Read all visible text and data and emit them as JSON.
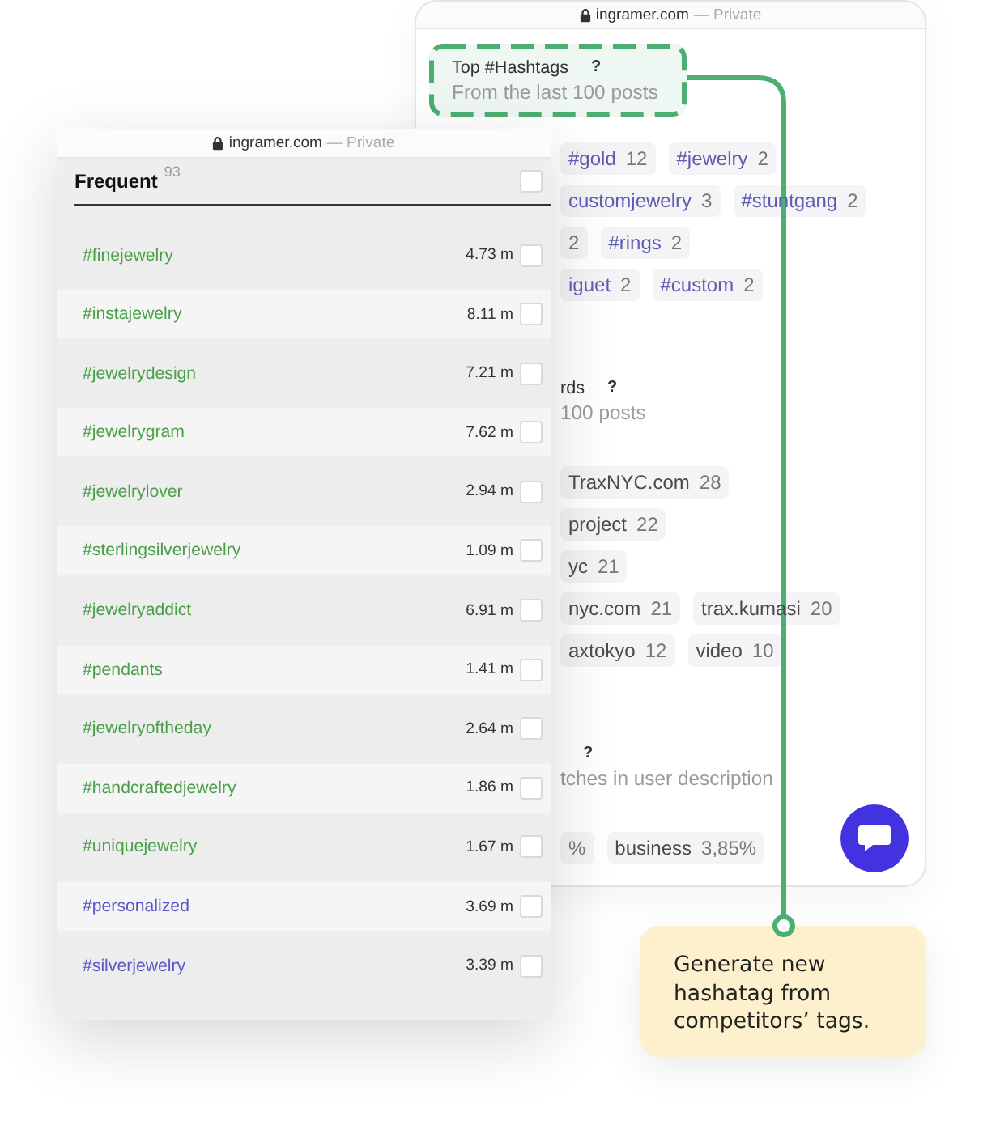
{
  "back_window": {
    "address_bar": {
      "domain": "ingramer.com",
      "mode": "— Private"
    },
    "sections": [
      {
        "kind": "hashtags",
        "highlighted": true,
        "title": "Top #Hashtags",
        "help": "?",
        "subtitle": "From the last 100 posts",
        "chip_rows": [
          [
            {
              "label": "#gold",
              "count": "12"
            },
            {
              "label": "#jewelry",
              "count": "2"
            }
          ],
          [
            {
              "label": "customjewelry",
              "count": "3"
            },
            {
              "label": "#stuntgang",
              "count": "2"
            }
          ],
          [
            {
              "count": "2"
            },
            {
              "label": "#rings",
              "count": "2"
            }
          ],
          [
            {
              "label": "iguet",
              "count": "2"
            },
            {
              "label": "#custom",
              "count": "2"
            }
          ]
        ]
      },
      {
        "kind": "words",
        "highlighted": false,
        "title": "rds",
        "help": "?",
        "subtitle": "100 posts",
        "chip_rows": [
          [
            {
              "label": "TraxNYC.com",
              "count": "28"
            }
          ],
          [
            {
              "label": "project",
              "count": "22"
            }
          ],
          [
            {
              "label": "yc",
              "count": "21"
            }
          ],
          [
            {
              "label": "nyc.com",
              "count": "21"
            },
            {
              "label": "trax.kumasi",
              "count": "20"
            }
          ],
          [
            {
              "label": "axtokyo",
              "count": "12"
            },
            {
              "label": "video",
              "count": "10"
            }
          ]
        ]
      },
      {
        "kind": "words",
        "highlighted": false,
        "help": "?",
        "subtitle": "tches in user description",
        "chip_rows": [
          [
            {
              "count": "%"
            },
            {
              "label": "business",
              "count": "3,85%"
            }
          ]
        ]
      }
    ]
  },
  "front_window": {
    "address_bar": {
      "domain": "ingramer.com",
      "mode": "— Private"
    },
    "heading": "Frequent",
    "total": "93",
    "select_all": {
      "checked": false
    },
    "rows": [
      {
        "tag": "#finejewelry",
        "color": "#4a9f48",
        "reach": "4.73 m",
        "checked": false
      },
      {
        "tag": "#instajewelry",
        "color": "#4a9f48",
        "reach": "8.11 m",
        "checked": false
      },
      {
        "tag": "#jewelrydesign",
        "color": "#4a9f48",
        "reach": "7.21 m",
        "checked": false
      },
      {
        "tag": "#jewelrygram",
        "color": "#4a9f48",
        "reach": "7.62 m",
        "checked": false
      },
      {
        "tag": "#jewelrylover",
        "color": "#4a9f48",
        "reach": "2.94 m",
        "checked": false
      },
      {
        "tag": "#sterlingsilverjewelry",
        "color": "#4a9f48",
        "reach": "1.09 m",
        "checked": false
      },
      {
        "tag": "#jewelryaddict",
        "color": "#4a9f48",
        "reach": "6.91 m",
        "checked": false
      },
      {
        "tag": "#pendants",
        "color": "#4a9f48",
        "reach": "1.41 m",
        "checked": false
      },
      {
        "tag": "#jewelryoftheday",
        "color": "#4a9f48",
        "reach": "2.64 m",
        "checked": false
      },
      {
        "tag": "#handcraftedjewelry",
        "color": "#4a9f48",
        "reach": "1.86 m",
        "checked": false
      },
      {
        "tag": "#uniquejewelry",
        "color": "#4a9f48",
        "reach": "1.67 m",
        "checked": false
      },
      {
        "tag": "#personalized",
        "color": "#5a58c8",
        "reach": "3.69 m",
        "checked": false
      },
      {
        "tag": "#silverjewelry",
        "color": "#5a58c8",
        "reach": "3.39 m",
        "checked": false
      }
    ]
  },
  "callout": {
    "text": "Generate new hashatag from competitors’ tags."
  }
}
